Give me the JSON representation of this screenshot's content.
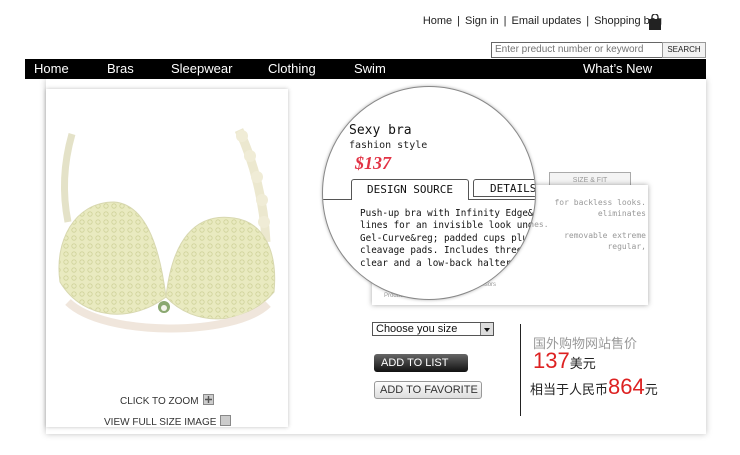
{
  "header": {
    "links": [
      "Home",
      "Sign in",
      "Email updates",
      "Shopping bag"
    ],
    "separator": "|",
    "search_placeholder": "Enter preduct number or keyword",
    "search_button": "SEARCH"
  },
  "nav": {
    "items": [
      "Home",
      "Bras",
      "Sleepwear",
      "Clothing",
      "Swim"
    ],
    "right_item": "What’s  New"
  },
  "product": {
    "name": "Sexy bra",
    "subtitle": "fashion style",
    "price": "$137",
    "tabs": [
      "DESIGN SOURCE",
      "DETAILS",
      "SIZE & FIT"
    ],
    "description_lines": [
      "Push-up bra with Infinity Edge&reg; that eliminates",
      "lines for an invisible look under clothes.",
      "Gel-Curve&reg; padded cups plus removable extreme",
      "cleavage pads. Includes three straps: regular,",
      "clear and a low-back halter."
    ],
    "background_text_lines": [
      "for backless looks.",
      "eliminates",
      "clothes.",
      "removable extreme",
      "regular,"
    ],
    "background_footer_1": "our Fashion Advisors",
    "background_footer_2": "Product Code: 4-006",
    "size_select": "Choose you size",
    "add_to_list": "ADD TO LIST",
    "add_to_favorite": "ADD TO FAVORITE"
  },
  "image_links": {
    "zoom": "CLICK TO ZOOM",
    "full_size": "VIEW FULL SIZE IMAGE"
  },
  "cn_price": {
    "label": "国外购物网站售价",
    "usd_value": "137",
    "usd_unit": "美元",
    "rmb_prefix": "相当于人民币",
    "rmb_value": "864",
    "rmb_unit": "元"
  },
  "colors": {
    "price_red": "#e23345",
    "nav_bg": "#000000",
    "cn_red": "#dd2222"
  }
}
